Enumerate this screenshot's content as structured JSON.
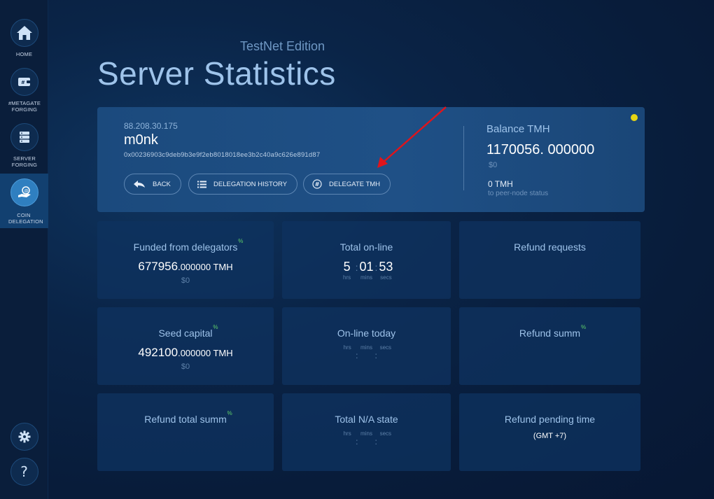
{
  "sidebar": {
    "items": [
      {
        "label": "HOME",
        "icon": "home-icon"
      },
      {
        "label": "#METAGATE FORGING",
        "icon": "wallet-icon"
      },
      {
        "label": "SERVER FORGING",
        "icon": "server-icon"
      },
      {
        "label": "COIN DELEGATION",
        "icon": "coin-hand-icon"
      }
    ],
    "settings_icon": "gear-icon",
    "help_icon": "question-icon",
    "help_glyph": "?"
  },
  "header": {
    "edition": "TestNet Edition",
    "title": "Server Statistics"
  },
  "server": {
    "ip": "88.208.30.175",
    "name": "m0nk",
    "address": "0x00236903c9deb9b3e9f2eb8018018ee3b2c40a9c626e891d87",
    "buttons": {
      "back": "BACK",
      "history": "DELEGATION HISTORY",
      "delegate": "DELEGATE TMH"
    },
    "balance_label": "Balance TMH",
    "balance_value": "1170056. 000000",
    "balance_usd": "$0",
    "peer_value": "0 TMH",
    "peer_label": "to peer-node status",
    "status_color": "#e7d514"
  },
  "tiles": {
    "funded": {
      "title": "Funded from delegators",
      "mark": "%",
      "amount_int": "677956",
      "amount_rest": ".000000 TMH",
      "usd": "$0"
    },
    "total_online": {
      "title": "Total on-line",
      "hrs": "5",
      "mins": "01",
      "secs": "53",
      "hrs_lbl": "hrs",
      "mins_lbl": "mins",
      "secs_lbl": "secs"
    },
    "refund_requests": {
      "title": "Refund requests"
    },
    "seed": {
      "title": "Seed capital",
      "mark": "%",
      "amount_int": "492100",
      "amount_rest": ".000000 TMH",
      "usd": "$0"
    },
    "online_today": {
      "title": "On-line today",
      "hrs_lbl": "hrs",
      "mins_lbl": "mins",
      "secs_lbl": "secs"
    },
    "refund_summ": {
      "title": "Refund summ",
      "mark": "%"
    },
    "refund_total": {
      "title": "Refund total summ",
      "mark": "%"
    },
    "na_state": {
      "title": "Total N/A state",
      "hrs_lbl": "hrs",
      "mins_lbl": "mins",
      "secs_lbl": "secs"
    },
    "refund_pending": {
      "title": "Refund pending time",
      "tz": "(GMT +7)"
    }
  },
  "colors": {
    "accent": "#9ec3ea",
    "card": "#1f5086",
    "annotation_arrow": "#e0141b"
  }
}
